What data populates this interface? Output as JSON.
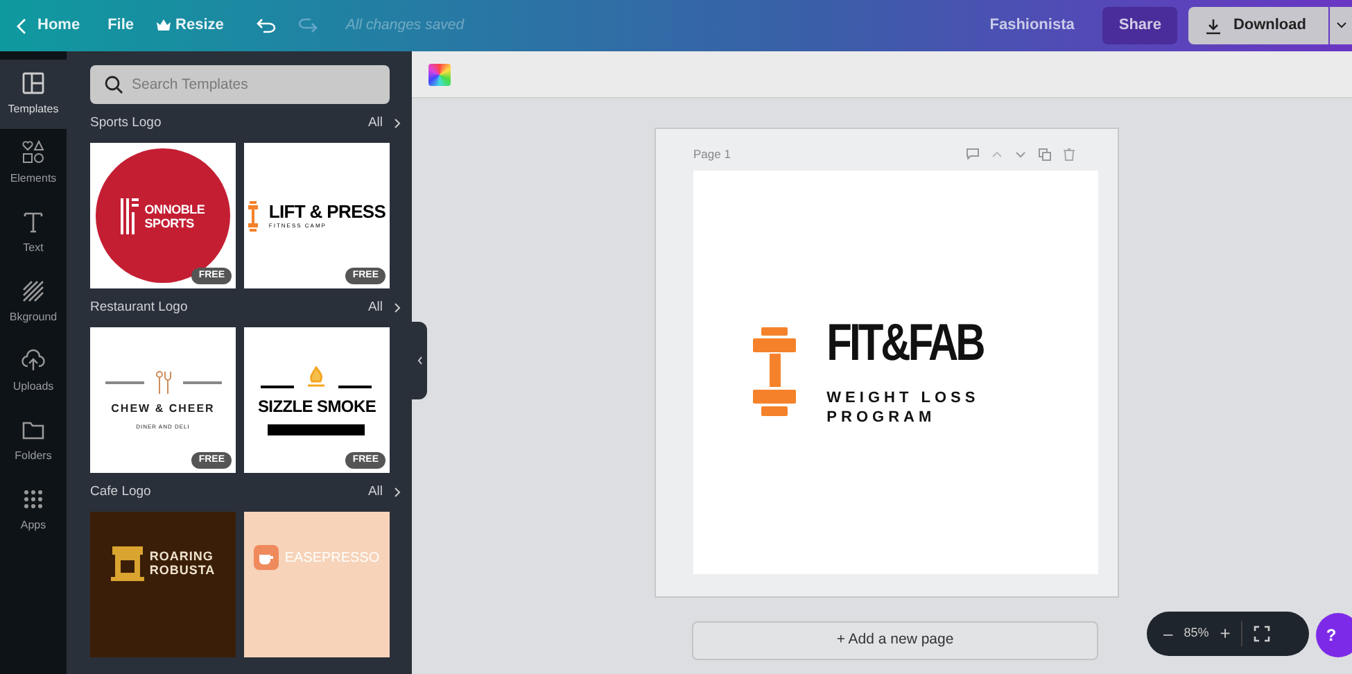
{
  "topbar": {
    "back": "Home",
    "menu": [
      {
        "label": "File",
        "kind": "plain"
      },
      {
        "label": "Resize",
        "kind": "crown"
      }
    ],
    "status": "All changes saved",
    "design_name": "Fashionista",
    "share": "Share",
    "download": "Download"
  },
  "rail": [
    {
      "label": "Templates",
      "kind": "templates",
      "selected": true
    },
    {
      "label": "Elements",
      "kind": "elements",
      "selected": false
    },
    {
      "label": "Text",
      "kind": "text",
      "selected": false
    },
    {
      "label": "Bkground",
      "kind": "background",
      "selected": false
    },
    {
      "label": "Uploads",
      "kind": "uploads",
      "selected": false
    },
    {
      "label": "Folders",
      "kind": "folders",
      "selected": false
    },
    {
      "label": "Apps",
      "kind": "apps",
      "selected": false
    }
  ],
  "search": {
    "placeholder": "Search Templates"
  },
  "sections": [
    {
      "title": "Sports Logo",
      "all": "All",
      "templates": [
        {
          "kind": "sports",
          "lines": [
            "ONNOBLE",
            "SPORTS"
          ],
          "badge": "FREE"
        },
        {
          "kind": "fitness",
          "lines": [
            "LIFT & PRESS",
            "FITNESS CAMP"
          ],
          "badge": "FREE"
        }
      ]
    },
    {
      "title": "Restaurant Logo",
      "all": "All",
      "templates": [
        {
          "kind": "chew",
          "lines": [
            "CHEW & CHEER",
            "DINER AND DELI"
          ],
          "badge": "FREE"
        },
        {
          "kind": "sizzle",
          "lines": [
            "SIZZLE SMOKE"
          ],
          "badge": "FREE"
        }
      ]
    },
    {
      "title": "Cafe Logo",
      "all": "All",
      "templates": [
        {
          "kind": "roaring",
          "lines": [
            "ROARING",
            "ROBUSTA"
          ]
        },
        {
          "kind": "ease",
          "lines": [
            "EASEPRESSO"
          ]
        }
      ]
    }
  ],
  "page": {
    "label": "Page 1",
    "title": "FIT&FAB",
    "subtitle": [
      "WEIGHT LOSS",
      "PROGRAM"
    ]
  },
  "add_page": "+ Add a new page",
  "zoom": {
    "value": "85%",
    "minus": "–",
    "plus": "+"
  },
  "help": "?"
}
